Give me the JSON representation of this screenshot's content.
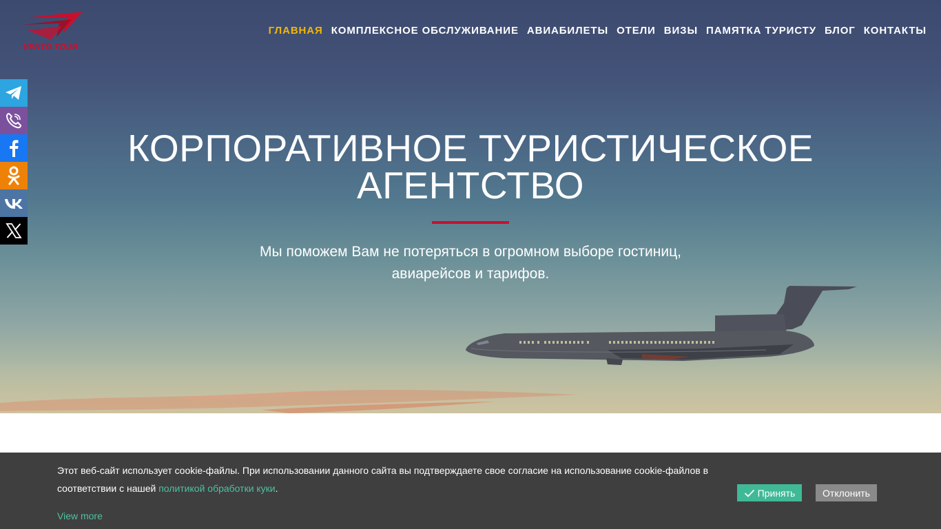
{
  "brand": {
    "logo_text": "VENTO TOUR",
    "accent_color": "#c8102e",
    "nav_active_color": "#f2b705"
  },
  "nav": {
    "items": [
      {
        "label": "ГЛАВНАЯ",
        "active": true
      },
      {
        "label": "КОМПЛЕКСНОЕ ОБСЛУЖИВАНИЕ",
        "active": false
      },
      {
        "label": "АВИАБИЛЕТЫ",
        "active": false
      },
      {
        "label": "ОТЕЛИ",
        "active": false
      },
      {
        "label": "ВИЗЫ",
        "active": false
      },
      {
        "label": "ПАМЯТКА ТУРИСТУ",
        "active": false
      },
      {
        "label": "БЛОГ",
        "active": false
      },
      {
        "label": "КОНТАКТЫ",
        "active": false
      }
    ]
  },
  "social": [
    {
      "icon": "telegram-icon",
      "color": "#2ca5e0"
    },
    {
      "icon": "viber-icon",
      "color": "#7b519d"
    },
    {
      "icon": "facebook-icon",
      "color": "#1877f2"
    },
    {
      "icon": "odnoklassniki-icon",
      "color": "#ee8208"
    },
    {
      "icon": "vk-icon",
      "color": "#4c75a3"
    },
    {
      "icon": "x-icon",
      "color": "#000000"
    }
  ],
  "hero": {
    "title_line1": "КОРПОРАТИВНОЕ ТУРИСТИЧЕСКОЕ",
    "title_line2": "АГЕНТСТВО",
    "subtitle_line1": "Мы поможем Вам не потеряться в огромном выборе гостиниц,",
    "subtitle_line2": "авиарейсов и тарифов."
  },
  "cookie": {
    "text": "Этот веб-сайт использует cookie-файлы. При использовании данного сайта вы подтверждаете свое согласие на использование cookie-файлов в соответствии с нашей ",
    "link_text": "политикой обработки куки",
    "text_end": ".",
    "more": "View more",
    "accept": "Принять",
    "decline": "Отклонить",
    "accept_color": "#40b996"
  }
}
